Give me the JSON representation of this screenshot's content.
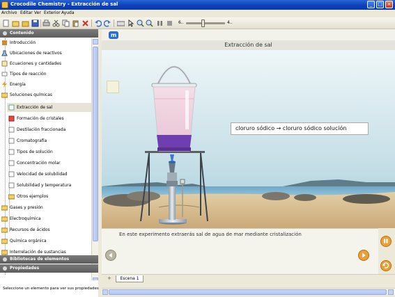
{
  "window": {
    "title": "Crocodile Chemistry - Extracción de sal"
  },
  "menu": [
    "Archivo",
    "Editar",
    "Ver",
    "Exterior",
    "Ayuda"
  ],
  "toolbar": {
    "zoom_min": "6..",
    "zoom_max": "4.."
  },
  "left_panel": {
    "header": "Contenido",
    "tree": [
      {
        "label": "Introducción",
        "icon": "book-icon"
      },
      {
        "label": "Ubicaciones de reactivos",
        "icon": "flask-icon"
      },
      {
        "label": "Ecuaciones y cantidades",
        "icon": "equation-icon"
      },
      {
        "label": "Tipos de reacción",
        "icon": "reaction-icon"
      },
      {
        "label": "Energía",
        "icon": "energy-icon"
      },
      {
        "label": "Soluciones químicas",
        "icon": "folder-icon"
      },
      {
        "label": "Extracción de sal",
        "icon": "page-icon"
      },
      {
        "label": "Formación de cristales",
        "icon": "page-icon"
      },
      {
        "label": "Destilación fraccionada",
        "icon": "page-icon"
      },
      {
        "label": "Cromatografía",
        "icon": "page-icon"
      },
      {
        "label": "Tipos de solución",
        "icon": "page-icon"
      },
      {
        "label": "Concentración molar",
        "icon": "page-icon"
      },
      {
        "label": "Velocidad de solubilidad",
        "icon": "page-icon"
      },
      {
        "label": "Solubilidad y temperatura",
        "icon": "page-icon"
      },
      {
        "label": "Otros ejemplos",
        "icon": "folder-icon"
      },
      {
        "label": "Gases y presión",
        "icon": "folder-icon"
      },
      {
        "label": "Electroquímica",
        "icon": "folder-icon"
      },
      {
        "label": "Recursos de ácidos",
        "icon": "folder-icon"
      },
      {
        "label": "Química orgánica",
        "icon": "folder-icon"
      },
      {
        "label": "Interrelación de sustancias",
        "icon": "folder-icon"
      }
    ],
    "elements_header": "Bibliotecas de elementos",
    "props_header": "Propiedades",
    "props_text": "Seleccione un elemento para ver sus propiedades"
  },
  "main": {
    "title": "Extracción de sal",
    "equation_label": "cloruro sódico → cloruro sódico solución",
    "description": "En este experimento extraerás sal de agua de mar mediante cristalización",
    "tab_label": "Escena 1"
  }
}
